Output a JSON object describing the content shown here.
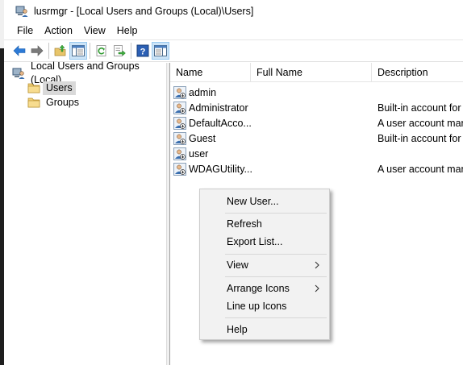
{
  "window": {
    "title": "lusrmgr - [Local Users and Groups (Local)\\Users]",
    "icon": "computer-users-icon"
  },
  "menubar": {
    "items": [
      "File",
      "Action",
      "View",
      "Help"
    ]
  },
  "toolbar": {
    "buttons": [
      "back-arrow-icon",
      "forward-arrow-icon",
      "up-folder-icon",
      "show-hide-tree-icon",
      "refresh-icon",
      "export-list-icon",
      "help-icon",
      "show-hide-action-pane-icon"
    ]
  },
  "tree": {
    "root": {
      "label": "Local Users and Groups (Local)",
      "icon": "computer-users-icon"
    },
    "children": [
      {
        "label": "Users",
        "icon": "folder-icon",
        "selected": true
      },
      {
        "label": "Groups",
        "icon": "folder-icon",
        "selected": false
      }
    ]
  },
  "list": {
    "columns": [
      "Name",
      "Full Name",
      "Description"
    ],
    "rows": [
      {
        "name": "admin",
        "full_name": "",
        "description": ""
      },
      {
        "name": "Administrator",
        "full_name": "",
        "description": "Built-in account for"
      },
      {
        "name": "DefaultAcco...",
        "full_name": "",
        "description": "A user account man"
      },
      {
        "name": "Guest",
        "full_name": "",
        "description": "Built-in account for"
      },
      {
        "name": "user",
        "full_name": "",
        "description": ""
      },
      {
        "name": "WDAGUtility...",
        "full_name": "",
        "description": "A user account man"
      }
    ]
  },
  "context_menu": {
    "items": [
      {
        "label": "New User...",
        "submenu": false
      },
      {
        "label": "Refresh",
        "submenu": false
      },
      {
        "label": "Export List...",
        "submenu": false
      },
      {
        "label": "View",
        "submenu": true
      },
      {
        "label": "Arrange Icons",
        "submenu": true
      },
      {
        "label": "Line up Icons",
        "submenu": false
      },
      {
        "label": "Help",
        "submenu": false
      }
    ]
  },
  "colors": {
    "selection": "#d9d9d9",
    "toolbar_pressed": "#cce4f7",
    "menu_bg": "#f2f2f2",
    "folder": "#e8c56a",
    "arrow_blue": "#2c7ad6"
  }
}
